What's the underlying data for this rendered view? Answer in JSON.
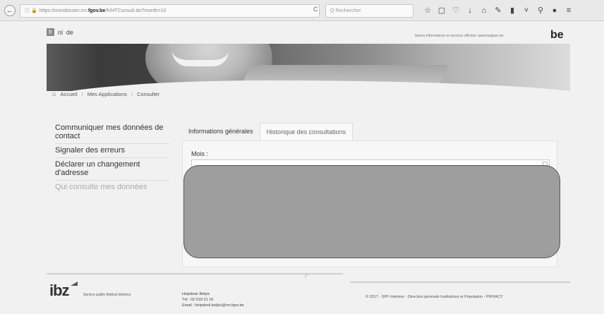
{
  "browser": {
    "back_glyph": "←",
    "url_icons": "ⓘ 🔒",
    "url_prefix": "https://mondossier.rrn.",
    "url_domain": "fgov.be",
    "url_suffix": "/fr/HTConsult.do?month=10",
    "reload_glyph": "C",
    "search_placeholder": "Q Rechercher",
    "toolbar_icons": [
      "☆",
      "▢",
      "♡",
      "↓",
      "⌂",
      "✎",
      "▮",
      "˅",
      "⚲",
      "●",
      "≡"
    ]
  },
  "header": {
    "lang_active": "fr",
    "lang_options": [
      "nl",
      "de"
    ],
    "gov_text": "Autres informations et services officiels: www.belgium.be",
    "logo": "be"
  },
  "breadcrumb": {
    "home_icon": "⌂",
    "items": [
      "Accueil",
      "Mes Applications",
      "Consulter"
    ]
  },
  "sidebar": {
    "items": [
      {
        "label": "Communiquer mes données de contact"
      },
      {
        "label": "Signaler des erreurs"
      },
      {
        "label": "Déclarer un changement d'adresse"
      },
      {
        "label": "Qui consulte mes données"
      }
    ]
  },
  "tabs": [
    "Informations générales",
    "Historique des consultations"
  ],
  "panel": {
    "month_label": "Mois :"
  },
  "footer": {
    "ibz_logo": "ibz",
    "ibz_text": "Service public fédéral Intérieur",
    "helpdesk_title": "Helpdesk Belpic",
    "helpdesk_phone": "Tél : 02 518 21 16",
    "helpdesk_email": "Email : helpdesk.belpic@rrn.fgov.be",
    "copyright": "© 2017 - SPF Intérieur - Direction générale Institutions et Population - PRIVACY"
  }
}
